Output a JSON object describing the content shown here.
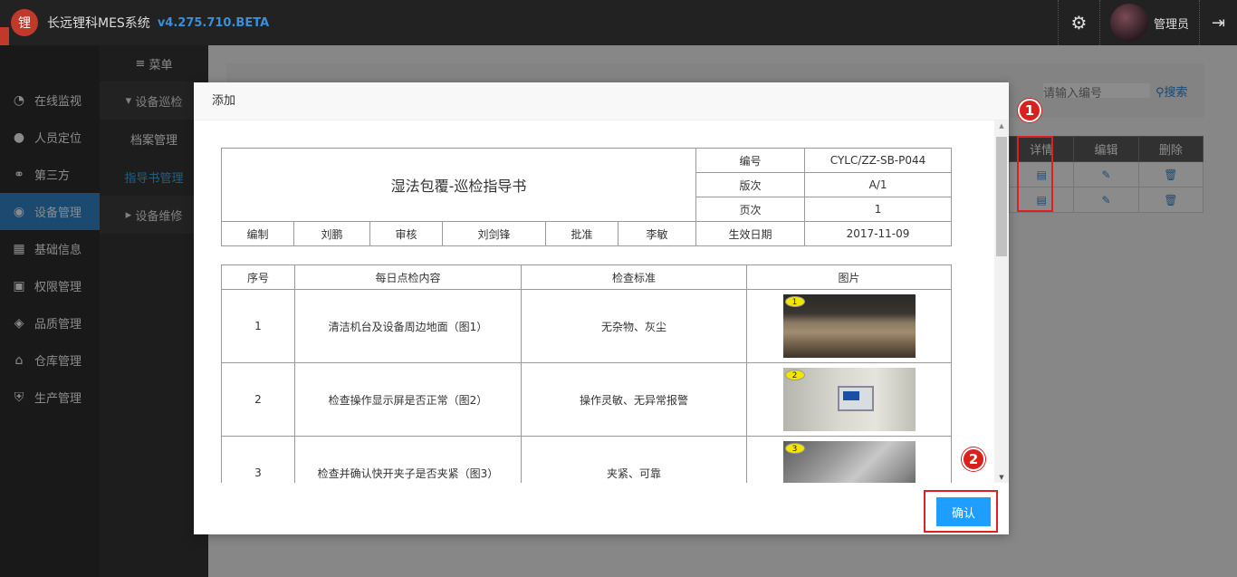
{
  "header": {
    "logo_text": "锂",
    "app_title": "长远锂科MES系统",
    "version": "v4.275.710.BETA",
    "user_name": "管理员"
  },
  "nav": {
    "items": [
      {
        "label": "在线监视",
        "icon": "gauge-icon"
      },
      {
        "label": "人员定位",
        "icon": "user-pin-icon"
      },
      {
        "label": "第三方",
        "icon": "handshake-icon"
      },
      {
        "label": "设备管理",
        "icon": "device-icon"
      },
      {
        "label": "基础信息",
        "icon": "grid-icon"
      },
      {
        "label": "权限管理",
        "icon": "lock-icon"
      },
      {
        "label": "品质管理",
        "icon": "shield-icon"
      },
      {
        "label": "仓库管理",
        "icon": "home-icon"
      },
      {
        "label": "生产管理",
        "icon": "shield-check-icon"
      }
    ],
    "active": "设备管理"
  },
  "subnav": {
    "menu_label": "菜单",
    "group1": "设备巡检",
    "item1": "档案管理",
    "item2": "指导书管理",
    "group2": "设备维修"
  },
  "background": {
    "search_placeholder": "请输入编号",
    "search_button": "搜索",
    "table_headers": [
      "详情",
      "编辑",
      "删除"
    ]
  },
  "badges": {
    "one": "1",
    "two": "2"
  },
  "modal": {
    "title": "添加",
    "doc_title": "湿法包覆-巡检指导书",
    "meta": {
      "code_label": "编号",
      "code_value": "CYLC/ZZ-SB-P044",
      "version_label": "版次",
      "version_value": "A/1",
      "page_label": "页次",
      "page_value": "1"
    },
    "sign": {
      "author_label": "编制",
      "author": "刘鹏",
      "review_label": "审核",
      "reviewer": "刘剑锋",
      "approve_label": "批准",
      "approver": "李敏",
      "effective_label": "生效日期",
      "effective_date": "2017-11-09"
    },
    "items_headers": [
      "序号",
      "每日点检内容",
      "检查标准",
      "图片"
    ],
    "items": [
      {
        "no": "1",
        "content": "清洁机台及设备周边地面（图1）",
        "standard": "无杂物、灰尘",
        "img_label": "1"
      },
      {
        "no": "2",
        "content": "检查操作显示屏是否正常（图2）",
        "standard": "操作灵敏、无异常报警",
        "img_label": "2"
      },
      {
        "no": "3",
        "content": "检查并确认快开夹子是否夹紧（图3）",
        "standard": "夹紧、可靠",
        "img_label": "3"
      }
    ],
    "confirm_label": "确认"
  }
}
